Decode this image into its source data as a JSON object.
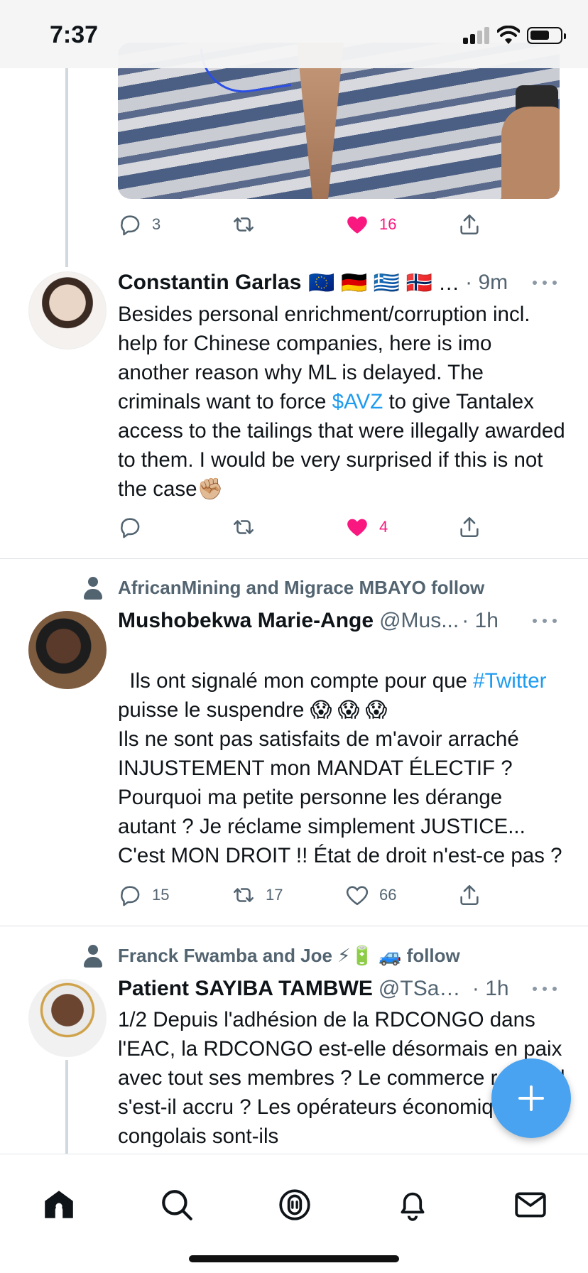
{
  "status_bar": {
    "time": "7:37"
  },
  "tweet_prev": {
    "reply_count": "3",
    "retweet_count": "",
    "like_count": "16"
  },
  "tweet1": {
    "name": "Constantin Garlas",
    "flags": "🇪🇺 🇩🇪 🇬🇷 🇳🇴 …",
    "time": "· 9m",
    "text_a": "Besides personal enrichment/corruption incl. help for Chinese companies, here is imo another reason why ML is delayed. The criminals want to force ",
    "cashtag": "$AVZ",
    "text_b": " to give Tantalex access to the tailings that were illegally awarded to them. I would be very surprised if this is not the case✊🏼",
    "reply_count": "",
    "retweet_count": "",
    "like_count": "4"
  },
  "tweet2": {
    "social_context": "AfricanMining and Migrace MBAYO follow",
    "name": "Mushobekwa Marie-Ange",
    "handle": "@Mus...",
    "time": "· 1h",
    "text_a": "Ils ont signalé mon compte pour que ",
    "hashtag": "#Twitter",
    "text_b": " puisse le suspendre 😱 😱 😱\nIls ne sont pas satisfaits de m'avoir arraché INJUSTEMENT mon MANDAT ÉLECTIF ? Pourquoi ma petite personne les dérange autant ? Je réclame simplement JUSTICE... C'est MON DROIT !! État de droit n'est-ce pas ?",
    "reply_count": "15",
    "retweet_count": "17",
    "like_count": "66"
  },
  "tweet3": {
    "social_context": "Franck Fwamba and Joe ⚡🔋 🚙 follow",
    "name": "Patient SAYIBA TAMBWE",
    "handle": "@TSayi...",
    "time": "· 1h",
    "text": "1/2 Depuis l'adhésion de la RDCONGO dans l'EAC, la RDCONGO est-elle désormais en paix avec tout ses membres ? Le commerce régional s'est-il accru ? Les opérateurs économiques congolais sont-ils"
  },
  "icons": {
    "reply": "reply-icon",
    "retweet": "retweet-icon",
    "like": "heart-icon",
    "share": "share-icon",
    "compose": "compose-plus-icon",
    "tabs": [
      "home-icon",
      "search-icon",
      "spaces-icon",
      "notifications-icon",
      "messages-icon"
    ]
  },
  "colors": {
    "accent": "#1d9bf0",
    "like": "#f91880",
    "fab": "#4aa3f0",
    "muted": "#536471"
  }
}
